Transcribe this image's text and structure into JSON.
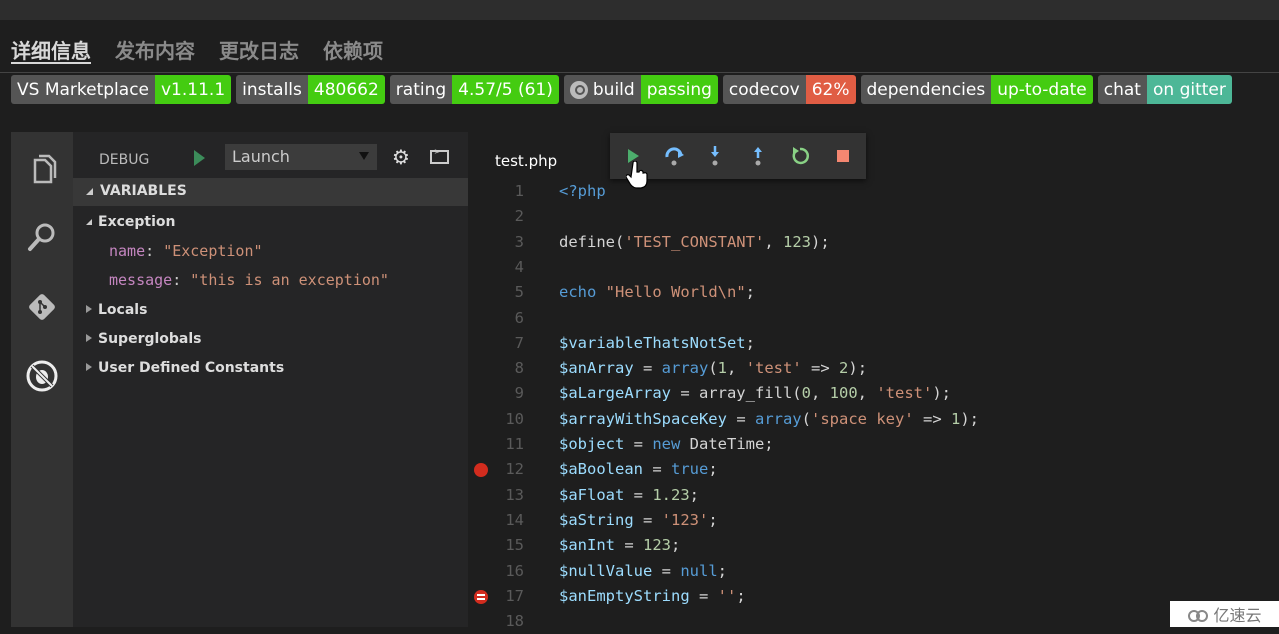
{
  "tabs": [
    {
      "label": "详细信息",
      "active": true
    },
    {
      "label": "发布内容",
      "active": false
    },
    {
      "label": "更改日志",
      "active": false
    },
    {
      "label": "依赖项",
      "active": false
    }
  ],
  "badges": [
    {
      "label": "VS Marketplace",
      "value": "v1.11.1",
      "color": "#4c1"
    },
    {
      "label": "installs",
      "value": "480662",
      "color": "#4c1"
    },
    {
      "label": "rating",
      "value": "4.57/5 (61)",
      "color": "#4c1"
    },
    {
      "label": "build",
      "value": "passing",
      "color": "#4c1",
      "icon": "appveyor-icon"
    },
    {
      "label": "codecov",
      "value": "62%",
      "color": "#e05d44"
    },
    {
      "label": "dependencies",
      "value": "up-to-date",
      "color": "#4c1"
    },
    {
      "label": "chat",
      "value": "on gitter",
      "color": "#4db797"
    }
  ],
  "activity_bar": [
    "explorer-icon",
    "search-icon",
    "git-icon",
    "debug-icon"
  ],
  "debug_panel": {
    "title": "DEBUG",
    "launch_config": "Launch",
    "section": "VARIABLES",
    "scopes": [
      {
        "label": "Exception",
        "expanded": true,
        "children": [
          {
            "key": "name",
            "value": "\"Exception\""
          },
          {
            "key": "message",
            "value": "\"this is an exception\""
          }
        ]
      },
      {
        "label": "Locals",
        "expanded": false
      },
      {
        "label": "Superglobals",
        "expanded": false
      },
      {
        "label": "User Defined Constants",
        "expanded": false
      }
    ]
  },
  "editor": {
    "file_tab": "test.php",
    "debug_toolbar": [
      "continue",
      "step-over",
      "step-into",
      "step-out",
      "restart",
      "stop"
    ],
    "breakpoints": {
      "12": "breakpoint",
      "17": "conditional-breakpoint"
    },
    "lines": [
      {
        "n": "1"
      },
      {
        "n": "2"
      },
      {
        "n": "3"
      },
      {
        "n": "4"
      },
      {
        "n": "5"
      },
      {
        "n": "6"
      },
      {
        "n": "7"
      },
      {
        "n": "8"
      },
      {
        "n": "9"
      },
      {
        "n": "10"
      },
      {
        "n": "11"
      },
      {
        "n": "12"
      },
      {
        "n": "13"
      },
      {
        "n": "14"
      },
      {
        "n": "15"
      },
      {
        "n": "16"
      },
      {
        "n": "17"
      },
      {
        "n": "18"
      }
    ],
    "code": [
      [
        [
          "k",
          "<?php"
        ]
      ],
      [],
      [
        [
          "p",
          "define("
        ],
        [
          "s",
          "'TEST_CONSTANT'"
        ],
        [
          "p",
          ", "
        ],
        [
          "n",
          "123"
        ],
        [
          "p",
          ");"
        ]
      ],
      [],
      [
        [
          "k",
          "echo "
        ],
        [
          "s",
          "\"Hello World\\n\""
        ],
        [
          "p",
          ";"
        ]
      ],
      [],
      [
        [
          "v",
          "$variableThatsNotSet"
        ],
        [
          "p",
          ";"
        ]
      ],
      [
        [
          "v",
          "$anArray"
        ],
        [
          "p",
          " = "
        ],
        [
          "k",
          "array"
        ],
        [
          "p",
          "("
        ],
        [
          "n",
          "1"
        ],
        [
          "p",
          ", "
        ],
        [
          "s",
          "'test'"
        ],
        [
          "p",
          " => "
        ],
        [
          "n",
          "2"
        ],
        [
          "p",
          ");"
        ]
      ],
      [
        [
          "v",
          "$aLargeArray"
        ],
        [
          "p",
          " = array_fill("
        ],
        [
          "n",
          "0"
        ],
        [
          "p",
          ", "
        ],
        [
          "n",
          "100"
        ],
        [
          "p",
          ", "
        ],
        [
          "s",
          "'test'"
        ],
        [
          "p",
          ");"
        ]
      ],
      [
        [
          "v",
          "$arrayWithSpaceKey"
        ],
        [
          "p",
          " = "
        ],
        [
          "k",
          "array"
        ],
        [
          "p",
          "("
        ],
        [
          "s",
          "'space key'"
        ],
        [
          "p",
          " => "
        ],
        [
          "n",
          "1"
        ],
        [
          "p",
          ");"
        ]
      ],
      [
        [
          "v",
          "$object"
        ],
        [
          "p",
          " = "
        ],
        [
          "k",
          "new "
        ],
        [
          "p",
          "DateTime;"
        ]
      ],
      [
        [
          "v",
          "$aBoolean"
        ],
        [
          "p",
          " = "
        ],
        [
          "k",
          "true"
        ],
        [
          "p",
          ";"
        ]
      ],
      [
        [
          "v",
          "$aFloat"
        ],
        [
          "p",
          " = "
        ],
        [
          "n",
          "1.23"
        ],
        [
          "p",
          ";"
        ]
      ],
      [
        [
          "v",
          "$aString"
        ],
        [
          "p",
          " = "
        ],
        [
          "s",
          "'123'"
        ],
        [
          "p",
          ";"
        ]
      ],
      [
        [
          "v",
          "$anInt"
        ],
        [
          "p",
          " = "
        ],
        [
          "n",
          "123"
        ],
        [
          "p",
          ";"
        ]
      ],
      [
        [
          "v",
          "$nullValue"
        ],
        [
          "p",
          " = "
        ],
        [
          "k",
          "null"
        ],
        [
          "p",
          ";"
        ]
      ],
      [
        [
          "v",
          "$anEmptyString"
        ],
        [
          "p",
          " = "
        ],
        [
          "s",
          "''"
        ],
        [
          "p",
          ";"
        ]
      ],
      []
    ]
  },
  "watermark": "亿速云"
}
